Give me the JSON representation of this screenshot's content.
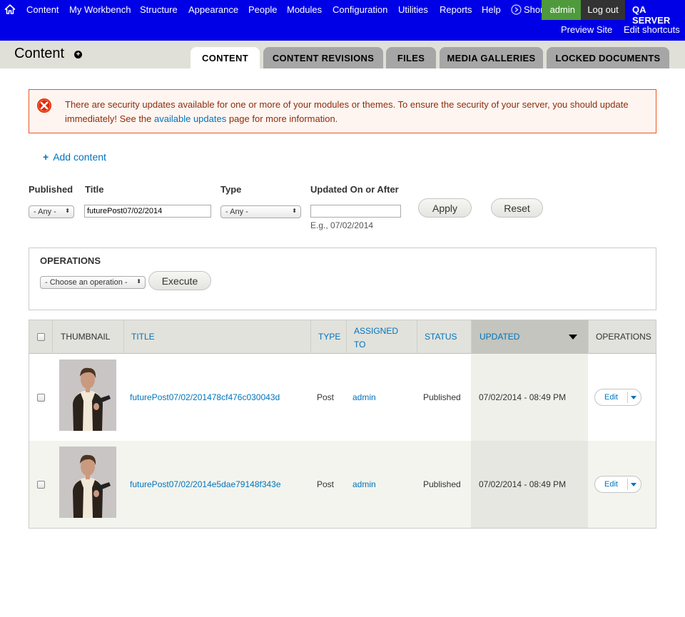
{
  "toolbar": {
    "menu": [
      "Content",
      "My Workbench",
      "Structure",
      "Appearance",
      "People",
      "Modules",
      "Configuration",
      "Utilities",
      "Reports",
      "Help"
    ],
    "shortcuts_label": "Shortcuts",
    "user_label": "admin",
    "logout_label": "Log out",
    "server_label": "QA SERVER",
    "preview_label": "Preview Site",
    "edit_shortcuts_label": "Edit shortcuts",
    "bg_color": "#0000e6"
  },
  "header": {
    "title": "Content",
    "tabs": [
      "CONTENT",
      "CONTENT REVISIONS",
      "FILES",
      "MEDIA GALLERIES",
      "LOCKED DOCUMENTS"
    ],
    "active_tab": "CONTENT"
  },
  "message": {
    "text_before": "There are security updates available for one or more of your modules or themes. To ensure the security of your server, you should update immediately! See the ",
    "link": "available updates",
    "text_after": " page for more information."
  },
  "actions": {
    "add_content": "Add content"
  },
  "filters": {
    "published_label": "Published",
    "published_value": "- Any -",
    "title_label": "Title",
    "title_value": "futurePost07/02/2014",
    "type_label": "Type",
    "type_value": "- Any -",
    "updated_label": "Updated On or After",
    "updated_value": "",
    "updated_hint": "E.g., 07/02/2014",
    "apply_label": "Apply",
    "reset_label": "Reset"
  },
  "operations": {
    "title": "OPERATIONS",
    "select_value": "- Choose an operation -",
    "execute_label": "Execute"
  },
  "table": {
    "headers": {
      "thumbnail": "THUMBNAIL",
      "title": "TITLE",
      "type": "TYPE",
      "assigned_line1": "ASSIGNED",
      "assigned_line2": "TO",
      "status": "STATUS",
      "updated": "UPDATED",
      "operations": "OPERATIONS"
    },
    "rows": [
      {
        "title": "futurePost07/02/201478cf476c030043d",
        "type": "Post",
        "assigned": "admin",
        "status": "Published",
        "updated": "07/02/2014 - 08:49 PM",
        "edit": "Edit"
      },
      {
        "title": "futurePost07/02/2014e5dae79148f343e",
        "type": "Post",
        "assigned": "admin",
        "status": "Published",
        "updated": "07/02/2014 - 08:49 PM",
        "edit": "Edit"
      }
    ]
  }
}
